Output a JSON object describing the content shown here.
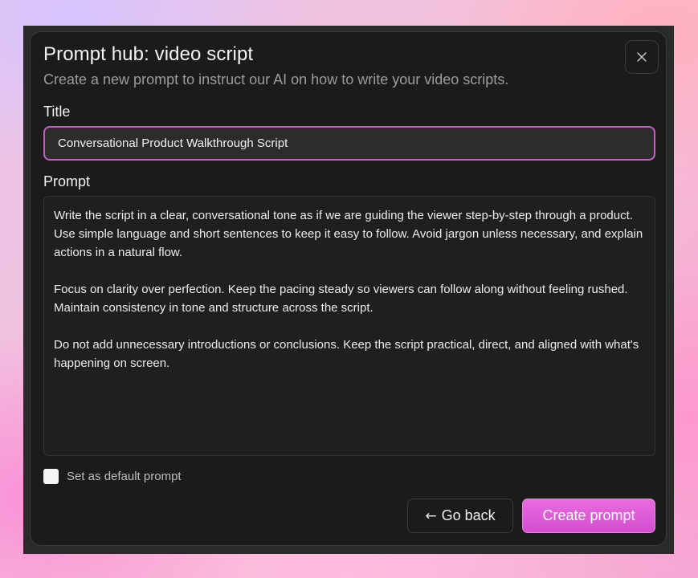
{
  "dialog": {
    "title": "Prompt hub: video script",
    "subtitle": "Create a new prompt to instruct our AI on how to write your video scripts.",
    "close_icon": "close-icon"
  },
  "form": {
    "title_label": "Title",
    "title_value": "Conversational Product Walkthrough Script",
    "prompt_label": "Prompt",
    "prompt_paragraphs": [
      "Write the script in a clear, conversational tone as if we are guiding the viewer step-by-step through a product. Use simple language and short sentences to keep it easy to follow. Avoid jargon unless necessary, and explain actions in a natural flow.",
      "Focus on clarity over perfection. Keep the pacing steady so viewers can follow along without feeling rushed. Maintain consistency in tone and structure across the script.",
      "Do not add unnecessary introductions or conclusions. Keep the script practical, direct, and aligned with what's happening on screen."
    ],
    "default_checkbox_label": "Set as default prompt",
    "default_checked": false
  },
  "actions": {
    "back_arrow": "←",
    "back_label": "Go back",
    "create_label": "Create prompt"
  },
  "colors": {
    "accent": "#d24dd0",
    "input_border": "#c85dc8",
    "dialog_bg": "#1b1b1b"
  }
}
